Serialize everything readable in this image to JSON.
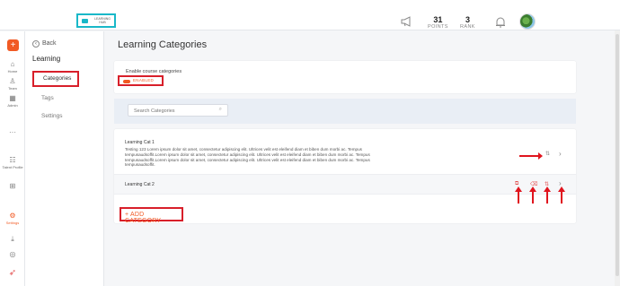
{
  "header": {
    "logo_text": "LEARNING HUB",
    "points_value": "31",
    "points_label": "POINTS",
    "rank_value": "3",
    "rank_label": "RANK"
  },
  "rail": {
    "items": [
      {
        "label": "Home",
        "icon": "home-icon"
      },
      {
        "label": "Team",
        "icon": "team-icon"
      },
      {
        "label": "Admin",
        "icon": "admin-icon"
      },
      {
        "label": "",
        "icon": "more-icon"
      },
      {
        "label": "Talent Profile",
        "icon": "talent-icon"
      },
      {
        "label": "",
        "icon": "grid-icon"
      },
      {
        "label": "Settings",
        "icon": "settings-icon"
      }
    ]
  },
  "sidebar": {
    "back_label": "Back",
    "section_title": "Learning",
    "items": [
      {
        "label": "Categories",
        "active": true
      },
      {
        "label": "Tags",
        "active": false
      },
      {
        "label": "Settings",
        "active": false
      }
    ]
  },
  "main": {
    "title": "Learning Categories",
    "enable_label": "Enable course categories",
    "toggle_state": "ENABLED",
    "search_placeholder": "Search Categories",
    "categories": [
      {
        "title": "Learning Cat 1",
        "description": "Testing 123 Lorem ipsum dolor sit amet, consectetur adipiscing elit. Ultrices velit est eleifend diam et biben dum morbi ac. Tempus tempusaudsoffit.Lorem ipsum dolor sit amet, consectetur adipiscing elit. Ultrices velit est eleifend diam et biben dum morbi ac. Tempus tempusaudsoffit.Lorem ipsum dolor sit amet, consectetur adipiscing elit. Ultrices velit est eleifend diam et biben dum morbi ac. Tempus tempusaudsoffit."
      },
      {
        "title": "Learning Cat 2",
        "description": ""
      }
    ],
    "add_label": "+ ADD CATEGORY"
  },
  "colors": {
    "accent": "#f15a24",
    "annotation_red": "#e0141e",
    "logo_border": "#19b8c8"
  }
}
